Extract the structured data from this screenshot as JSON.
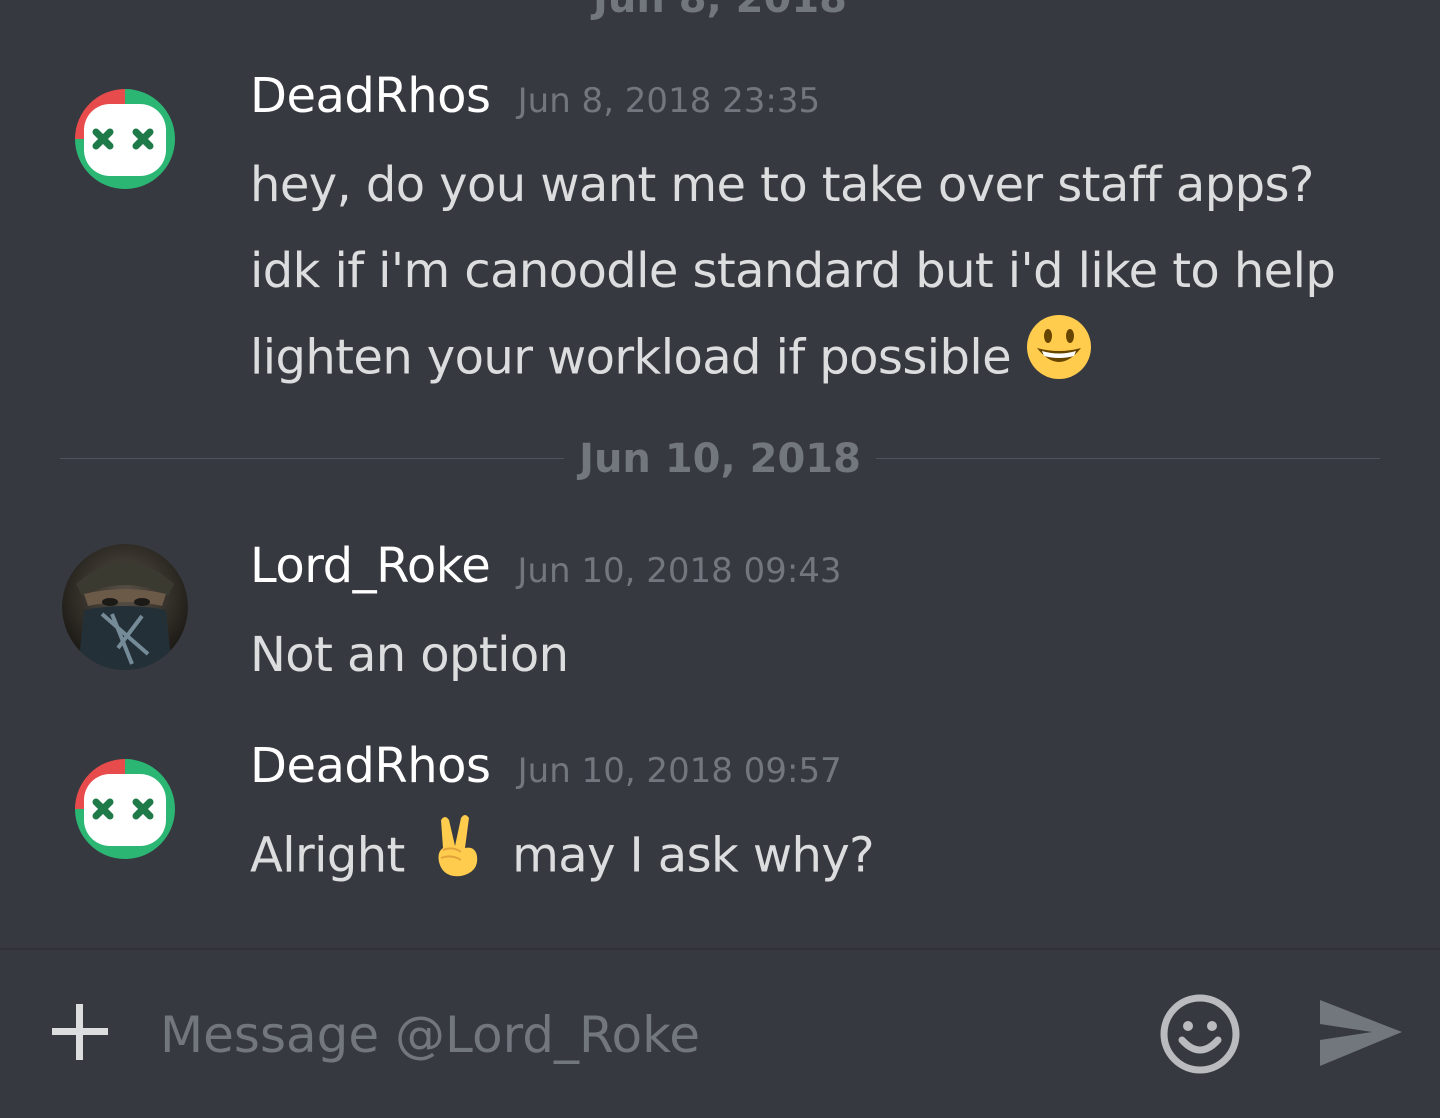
{
  "top_date_partial": "Jun 8, 2018",
  "messages": [
    {
      "author": "DeadRhos",
      "timestamp": "Jun 8, 2018 23:35",
      "text": "hey, do you want me to take over staff apps? idk if i'm canoodle standard but i'd like to help lighten your workload if possible",
      "trailing_emoji": "smiley-emoji"
    },
    {
      "author": "Lord_Roke",
      "timestamp": "Jun 10, 2018 09:43",
      "text": "Not an option"
    },
    {
      "author": "DeadRhos",
      "timestamp": "Jun 10, 2018 09:57",
      "text_before_emoji": "Alright",
      "inline_emoji": "victory-hand-emoji",
      "text_after_emoji": "may I ask why?"
    }
  ],
  "date_divider": {
    "label": "Jun 10, 2018"
  },
  "composer": {
    "placeholder": "Message @Lord_Roke",
    "value": "",
    "icons": [
      "plus-icon",
      "emoji-picker-icon",
      "send-icon"
    ]
  },
  "colors": {
    "background": "#36393f",
    "username": "#ffffff",
    "message_text": "#dcddde",
    "muted": "#72767d",
    "divider_line": "#4f545c"
  }
}
